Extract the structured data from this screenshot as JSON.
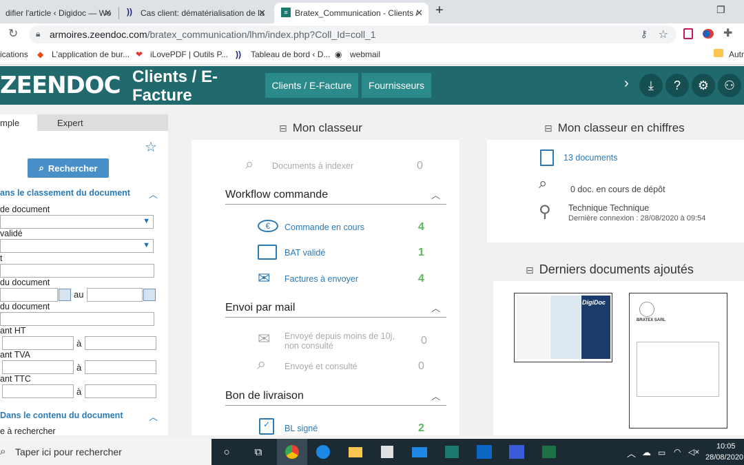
{
  "browser": {
    "tabs": [
      {
        "label": "difier l'article ‹ Digidoc — Wo"
      },
      {
        "label": "Cas client: dématérialisation de la"
      },
      {
        "label": "Bratex_Communication - Clients /"
      }
    ],
    "url_host": "armoires.zeendoc.com",
    "url_path": "/bratex_communication/lhm/index.php?Coll_Id=coll_1",
    "bookmarks": [
      "ications",
      "L'application de bur...",
      "iLovePDF | Outils P...",
      "Tableau de bord ‹ D...",
      "webmail",
      "Autr"
    ]
  },
  "header": {
    "logo": "ZEENDOC",
    "title": "Clients / E-Facture",
    "nav": [
      "Clients / E-Facture",
      "Fournisseurs"
    ]
  },
  "sidebar": {
    "tabs": [
      "mple",
      "Expert"
    ],
    "search_label": "Rechercher",
    "section1": "ans le classement du document",
    "fields": [
      "de document",
      "validé",
      "t",
      "du document",
      "du document",
      "ant HT",
      "ant TVA",
      "ant TTC"
    ],
    "au": "au",
    "a": "à",
    "section2": "Dans le contenu du document",
    "last_label": "e à rechercher"
  },
  "classeur": {
    "title": "Mon classeur",
    "to_index_label": "Documents à indexer",
    "to_index_count": "0",
    "groups": [
      {
        "name": "Workflow commande",
        "items": [
          {
            "label": "Commande en cours",
            "count": "4"
          },
          {
            "label": "BAT validé",
            "count": "1"
          },
          {
            "label": "Factures à envoyer",
            "count": "4"
          }
        ]
      },
      {
        "name": "Envoi par mail",
        "items": [
          {
            "label": "Envoyé depuis moins de 10j, non consulté",
            "count": "0"
          },
          {
            "label": "Envoyé et consulté",
            "count": "0"
          }
        ]
      },
      {
        "name": "Bon de livraison",
        "items": [
          {
            "label": "BL signé",
            "count": "2"
          }
        ]
      }
    ]
  },
  "stats": {
    "title": "Mon classeur en chiffres",
    "documents": "13 documents",
    "depot": "0 doc. en cours de dépôt",
    "user": "Technique Technique",
    "last_login": "Dernière connexion : 28/08/2020 à 09:54"
  },
  "recent": {
    "title": "Derniers documents ajoutés",
    "thumb1_text": "DigiDoc",
    "thumb2_text": "BRATEX SARL"
  },
  "taskbar": {
    "search": "Taper ici pour rechercher",
    "time": "10:05",
    "date": "28/08/2020"
  },
  "colors": {
    "header": "#206a6e",
    "nav_button": "#2b8a8a",
    "link": "#2a7ab8",
    "count": "#5cb85c"
  }
}
